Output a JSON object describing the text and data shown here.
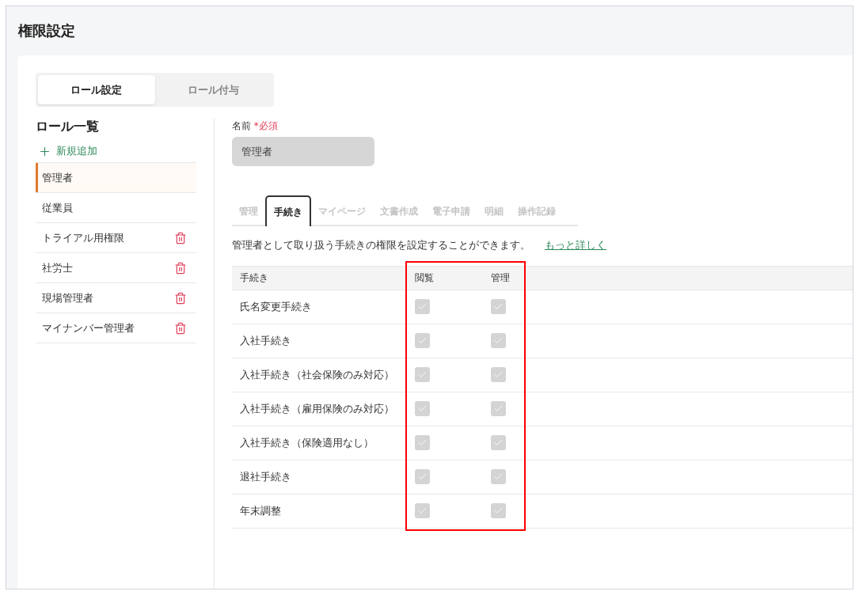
{
  "page_title": "権限設定",
  "top_tabs": [
    {
      "label": "ロール設定",
      "selected": true
    },
    {
      "label": "ロール付与",
      "selected": false
    }
  ],
  "role_list": {
    "title": "ロール一覧",
    "add_label": "新規追加",
    "items": [
      {
        "name": "管理者",
        "selected": true,
        "deletable": false
      },
      {
        "name": "従業員",
        "selected": false,
        "deletable": false
      },
      {
        "name": "トライアル用権限",
        "selected": false,
        "deletable": true
      },
      {
        "name": "社労士",
        "selected": false,
        "deletable": true
      },
      {
        "name": "現場管理者",
        "selected": false,
        "deletable": true
      },
      {
        "name": "マイナンバー管理者",
        "selected": false,
        "deletable": true
      }
    ]
  },
  "name_field": {
    "label": "名前",
    "required": "*必須",
    "value": "管理者",
    "disabled": true
  },
  "section_tabs": [
    {
      "label": "管理",
      "selected": false
    },
    {
      "label": "手続き",
      "selected": true
    },
    {
      "label": "マイページ",
      "selected": false
    },
    {
      "label": "文書作成",
      "selected": false
    },
    {
      "label": "電子申請",
      "selected": false
    },
    {
      "label": "明細",
      "selected": false
    },
    {
      "label": "操作記録",
      "selected": false
    }
  ],
  "description": "管理者として取り扱う手続きの権限を設定することができます。",
  "more_link": "もっと詳しく",
  "table": {
    "columns": [
      "手続き",
      "閲覧",
      "管理"
    ],
    "highlighted": true,
    "rows": [
      {
        "name": "氏名変更手続き",
        "view": {
          "checked": true,
          "disabled": true
        },
        "manage": {
          "checked": true,
          "disabled": true
        }
      },
      {
        "name": "入社手続き",
        "view": {
          "checked": true,
          "disabled": true
        },
        "manage": {
          "checked": true,
          "disabled": true
        }
      },
      {
        "name": "入社手続き（社会保険のみ対応）",
        "view": {
          "checked": true,
          "disabled": true
        },
        "manage": {
          "checked": true,
          "disabled": true
        }
      },
      {
        "name": "入社手続き（雇用保険のみ対応）",
        "view": {
          "checked": true,
          "disabled": true
        },
        "manage": {
          "checked": true,
          "disabled": true
        }
      },
      {
        "name": "入社手続き（保険適用なし）",
        "view": {
          "checked": true,
          "disabled": true
        },
        "manage": {
          "checked": true,
          "disabled": true
        }
      },
      {
        "name": "退社手続き",
        "view": {
          "checked": true,
          "disabled": true
        },
        "manage": {
          "checked": true,
          "disabled": true
        }
      },
      {
        "name": "年末調整",
        "view": {
          "checked": true,
          "disabled": true
        },
        "manage": {
          "checked": true,
          "disabled": true
        }
      }
    ]
  }
}
